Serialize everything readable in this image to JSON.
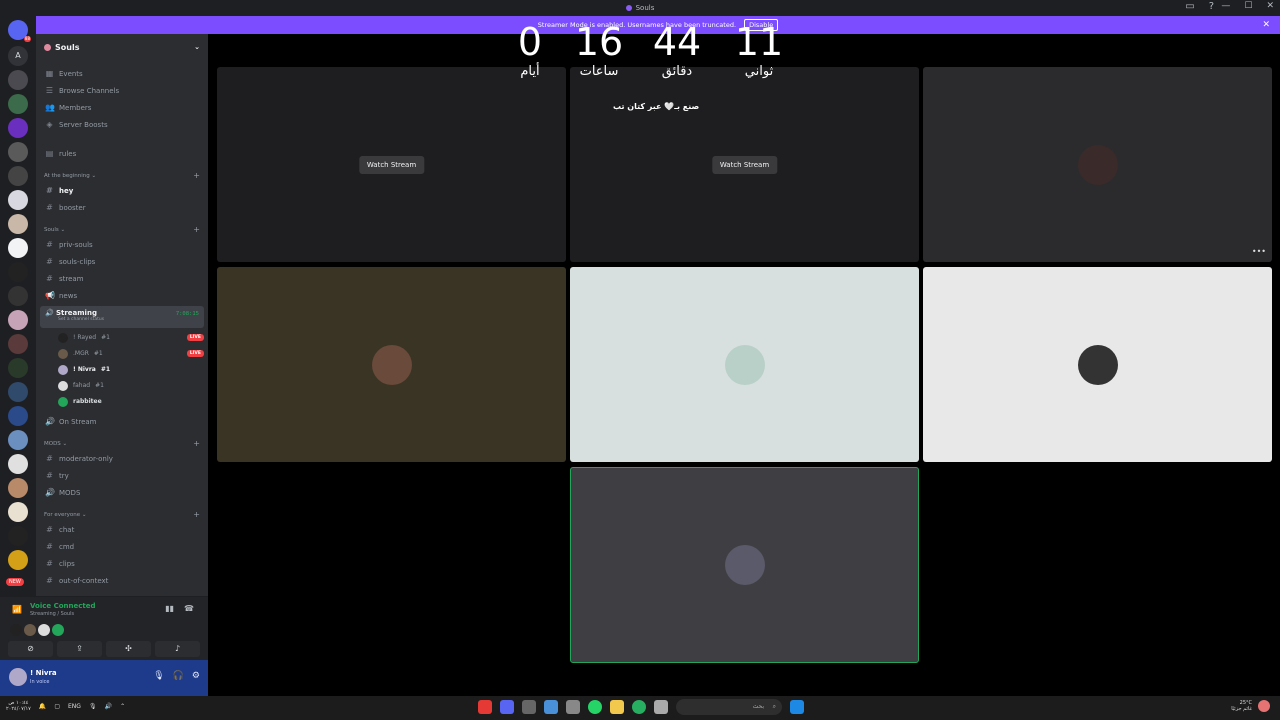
{
  "titlebar": {
    "title": "Souls"
  },
  "banner": {
    "text": "Streamer Mode is enabled. Usernames have been truncated.",
    "disable_label": "Disable"
  },
  "server_rail": {
    "home_badge": "88",
    "letter_server": "A",
    "new_badge": "NEW"
  },
  "sidebar": {
    "server_name": "Souls",
    "top_items": [
      "Events",
      "Browse Channels",
      "Members",
      "Server Boosts"
    ],
    "rules": "rules",
    "cat_beginning": "At the beginning",
    "ch_hey": "hey",
    "ch_booster": "booster",
    "cat_souls": "Souls",
    "souls_channels": [
      "priv-souls",
      "souls-clips",
      "stream",
      "news"
    ],
    "streaming": {
      "name": "Streaming",
      "status": "Set a channel status",
      "time": "7:08:15"
    },
    "voice_users": [
      {
        "name": "! Rayed",
        "tag": "#1",
        "live": "LIVE"
      },
      {
        "name": ".MGR",
        "tag": "#1",
        "live": "LIVE"
      },
      {
        "name": "! Nivra",
        "tag": "#1",
        "live": ""
      },
      {
        "name": "fahad",
        "tag": "#1",
        "live": ""
      },
      {
        "name": "rabbitee",
        "tag": "",
        "live": ""
      }
    ],
    "on_stream": "On Stream",
    "cat_mods": "MODS",
    "mods_channels": [
      "moderator-only",
      "try",
      "MODS"
    ],
    "cat_everyone": "For everyone",
    "everyone_channels": [
      "chat",
      "cmd",
      "clips",
      "out-of-context"
    ]
  },
  "voice_panel": {
    "title": "Voice Connected",
    "subtitle": "Streaming / Souls"
  },
  "user_panel": {
    "name": "! Nivra",
    "status": "In voice"
  },
  "stage": {
    "watch_stream_1": "Watch Stream",
    "watch_stream_2": "Watch Stream",
    "overlay_text": "صنع بـ🤍 عبر كتان تب"
  },
  "countdown": [
    {
      "value": "0",
      "label": "أيام"
    },
    {
      "value": "16",
      "label": "ساعات"
    },
    {
      "value": "44",
      "label": "دقائق"
    },
    {
      "value": "11",
      "label": "ثواني"
    }
  ],
  "taskbar": {
    "time": "١٠:٤٤ ص",
    "date": "٢٠٢٤/٠٧/١٧",
    "lang": "ENG",
    "search_placeholder": "بحث",
    "weather_temp": "25°C",
    "weather_desc": "غائم جزئيًا"
  },
  "colors": {
    "accent": "#7c4dff",
    "live": "#f23f43",
    "connected": "#23a55a",
    "sidebar": "#2b2d31"
  }
}
